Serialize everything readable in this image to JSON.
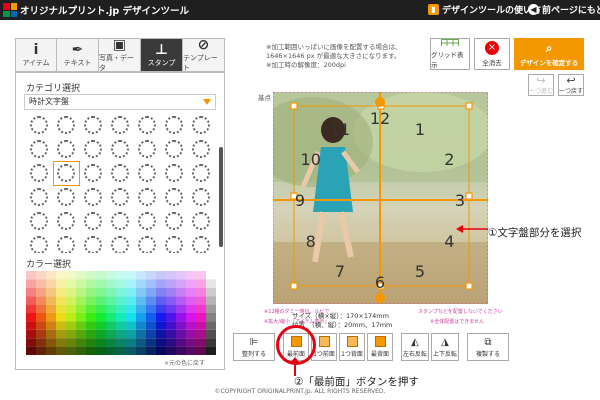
{
  "header": {
    "title": "オリジナルプリント.jp デザインツール",
    "help_link": "デザインツールの使い方",
    "back_link": "前ページにもどる",
    "logo_colors": [
      "#e60012",
      "#f39800",
      "#009944",
      "#0068b7"
    ]
  },
  "tools": [
    {
      "label": "アイテム",
      "icon": "info-icon"
    },
    {
      "label": "テキスト",
      "icon": "pen-icon"
    },
    {
      "label": "写真・データ",
      "icon": "image-icon"
    },
    {
      "label": "スタンプ",
      "icon": "stamp-icon",
      "active": true
    },
    {
      "label": "テンプレート",
      "icon": "compass-icon"
    }
  ],
  "panel": {
    "category_title": "カテゴリ選択",
    "category_value": "時計文字盤",
    "color_title": "カラー選択",
    "restore_color": "×元の色に戻す"
  },
  "canvas": {
    "notes": [
      "※加工範囲いっぱいに画像を配置する場合は、",
      "1646×1646 px が最適な大きさになります。",
      "※加工時の解像度：200dpi"
    ],
    "base_point": "基点",
    "clock_numbers": [
      "12",
      "1",
      "2",
      "3",
      "4",
      "5",
      "6",
      "7",
      "8",
      "9",
      "10",
      "11"
    ],
    "size_label": "サイズ（横×縦）：170×174mm",
    "position_label": "位置　（横、縦）：20mm、17mm",
    "pink_notes": [
      "※12種のダミー時計。ルビで",
      "※拡大/縮小「アイテム表示」",
      "スタンプなどを配置しないでください",
      "※全体配置はできません"
    ]
  },
  "right_buttons": {
    "grid": "グリッド表示",
    "clear": "全消去",
    "confirm": "デザインを確定する",
    "redo": "一つ進む",
    "undo": "一つ戻す"
  },
  "callouts": {
    "step1": "①文字盤部分を選択",
    "step2": "②「最前面」ボタンを押す"
  },
  "bottom_tools": [
    {
      "label": "整列する",
      "icon": "align-icon"
    },
    {
      "label": "最前面",
      "icon": "front-most-icon"
    },
    {
      "label": "1つ前面",
      "icon": "forward-icon"
    },
    {
      "label": "1つ背面",
      "icon": "backward-icon"
    },
    {
      "label": "最背面",
      "icon": "back-most-icon"
    },
    {
      "label": "左右反転",
      "icon": "flip-horizontal-icon"
    },
    {
      "label": "上下反転",
      "icon": "flip-vertical-icon"
    },
    {
      "label": "複製する",
      "icon": "duplicate-icon"
    }
  ],
  "footer": "©COPYRIGHT ORIGINALPRINT.jp. ALL RIGHTS RESERVED.",
  "colors": {
    "accent": "#f39800",
    "alert": "#e60012",
    "dark": "#1f1f1f"
  }
}
